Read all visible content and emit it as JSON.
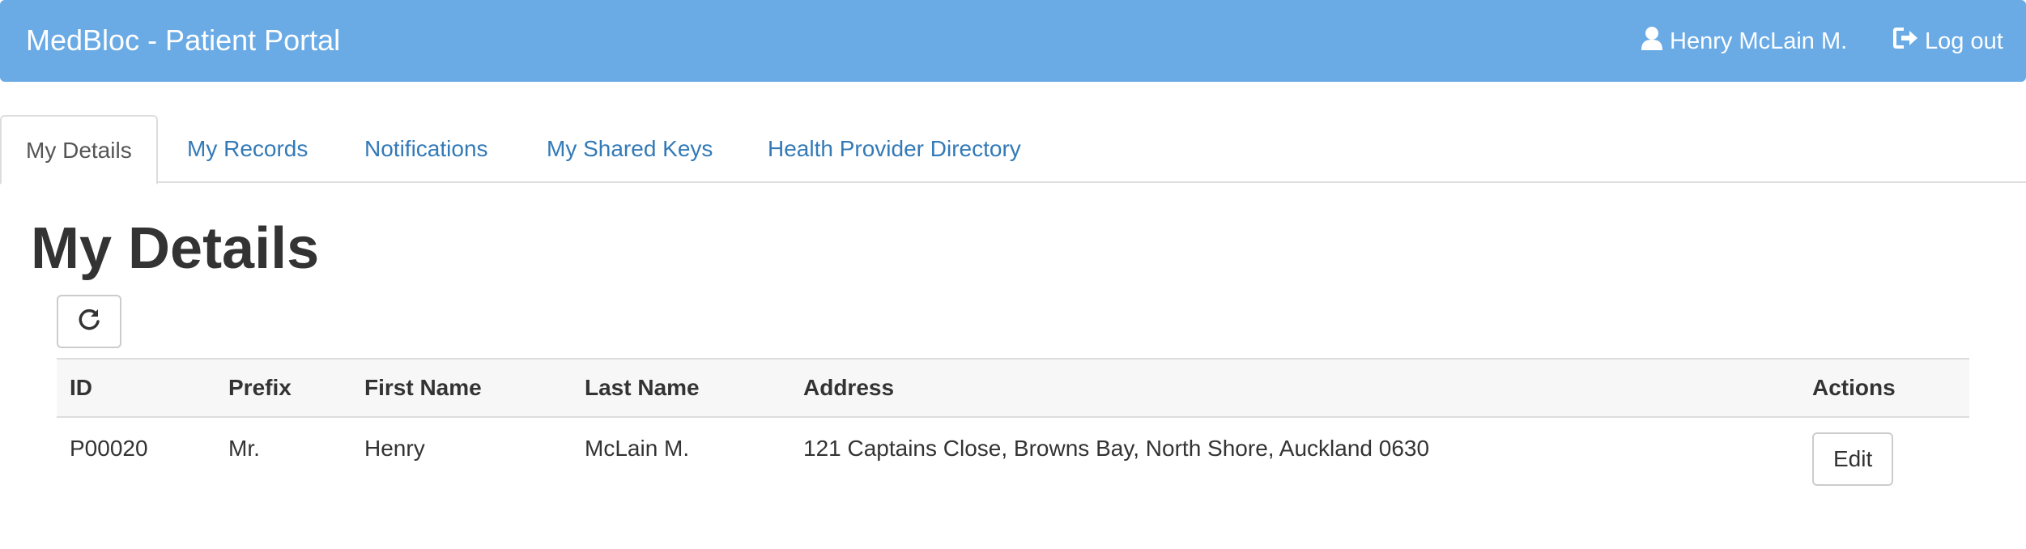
{
  "header": {
    "brand": "MedBloc - Patient Portal",
    "user_name": "Henry McLain M.",
    "logout_label": "Log out"
  },
  "tabs": [
    {
      "label": "My Details",
      "active": true
    },
    {
      "label": "My Records",
      "active": false
    },
    {
      "label": "Notifications",
      "active": false
    },
    {
      "label": "My Shared Keys",
      "active": false
    },
    {
      "label": "Health Provider Directory",
      "active": false
    }
  ],
  "main": {
    "title": "My Details",
    "refresh_icon": "refresh-icon"
  },
  "table": {
    "columns": [
      "ID",
      "Prefix",
      "First Name",
      "Last Name",
      "Address",
      "Actions"
    ],
    "rows": [
      {
        "id": "P00020",
        "prefix": "Mr.",
        "first_name": "Henry",
        "last_name": "McLain M.",
        "address": "121 Captains Close, Browns Bay, North Shore, Auckland 0630",
        "action_label": "Edit"
      }
    ]
  },
  "colors": {
    "navbar": "#6aabe6",
    "link": "#337ab7"
  }
}
